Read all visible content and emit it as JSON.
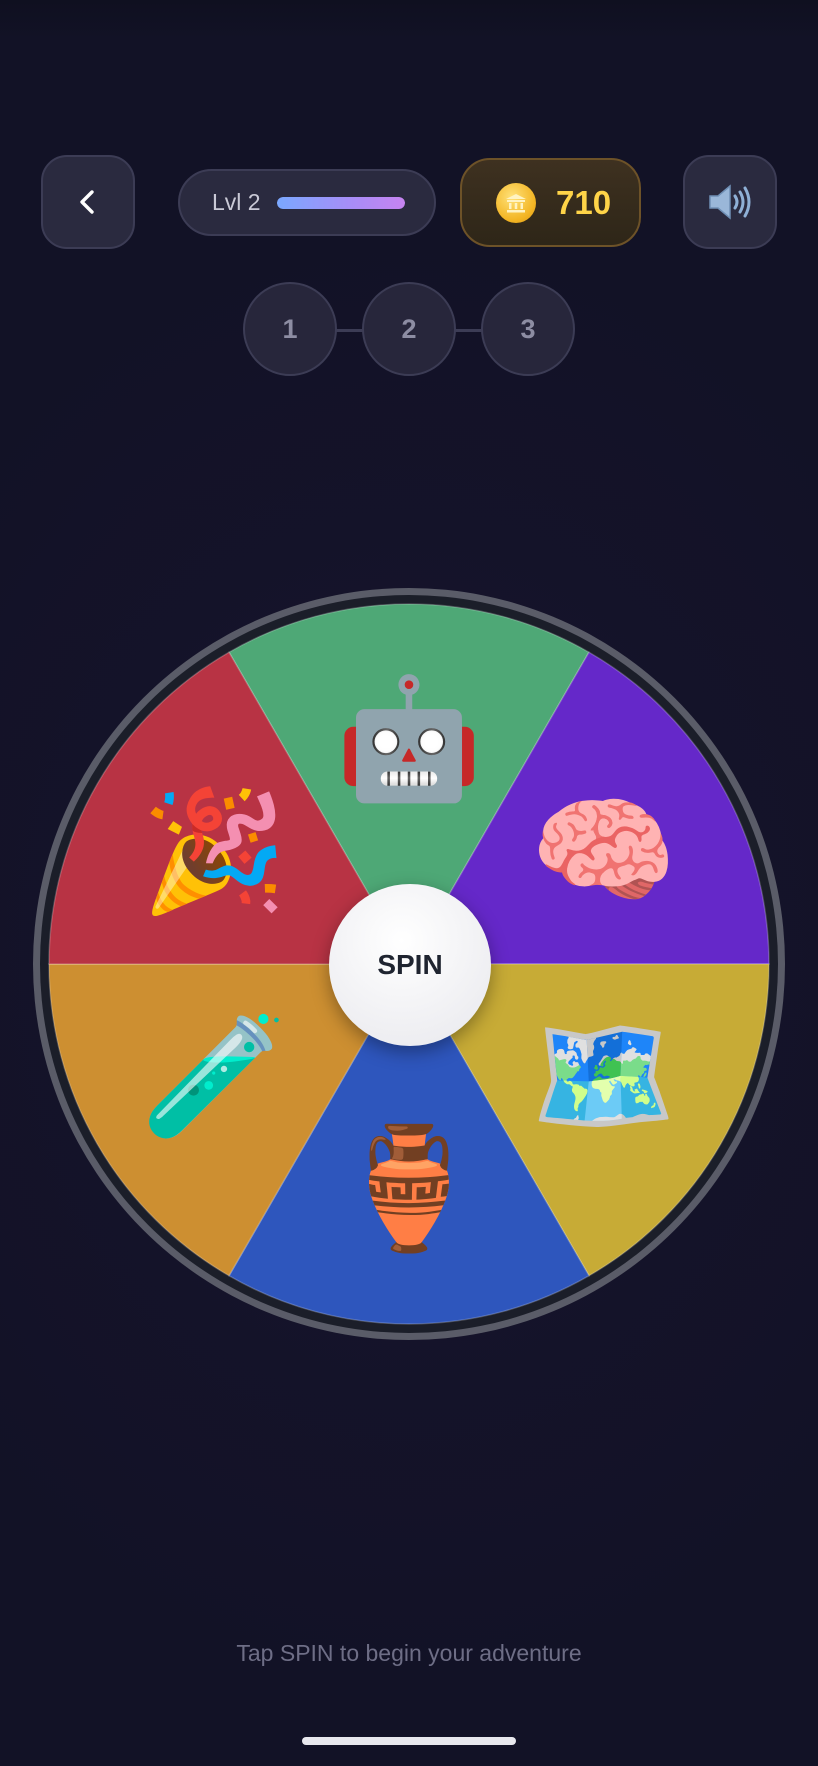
{
  "header": {
    "level_label": "Lvl 2",
    "level_progress": 1.0,
    "coins": "710",
    "icons": {
      "back": "chevron-left-icon",
      "coin": "coin-icon",
      "sound": "speaker-icon"
    }
  },
  "steps": [
    "1",
    "2",
    "3"
  ],
  "wheel": {
    "segments": [
      {
        "name": "robot",
        "icon": "🤖",
        "color": "#4ea876"
      },
      {
        "name": "brain",
        "icon": "🧠",
        "color": "#6528c9"
      },
      {
        "name": "map",
        "icon": "🗺️",
        "color": "#c7ab36"
      },
      {
        "name": "amphora",
        "icon": "🏺",
        "color": "#2e56bd"
      },
      {
        "name": "test-tube",
        "icon": "🧪",
        "color": "#cd8f31"
      },
      {
        "name": "party-popper",
        "icon": "🎉",
        "color": "#b83344"
      }
    ],
    "spin_label": "SPIN"
  },
  "footer": {
    "hint": "Tap SPIN to begin your adventure"
  }
}
